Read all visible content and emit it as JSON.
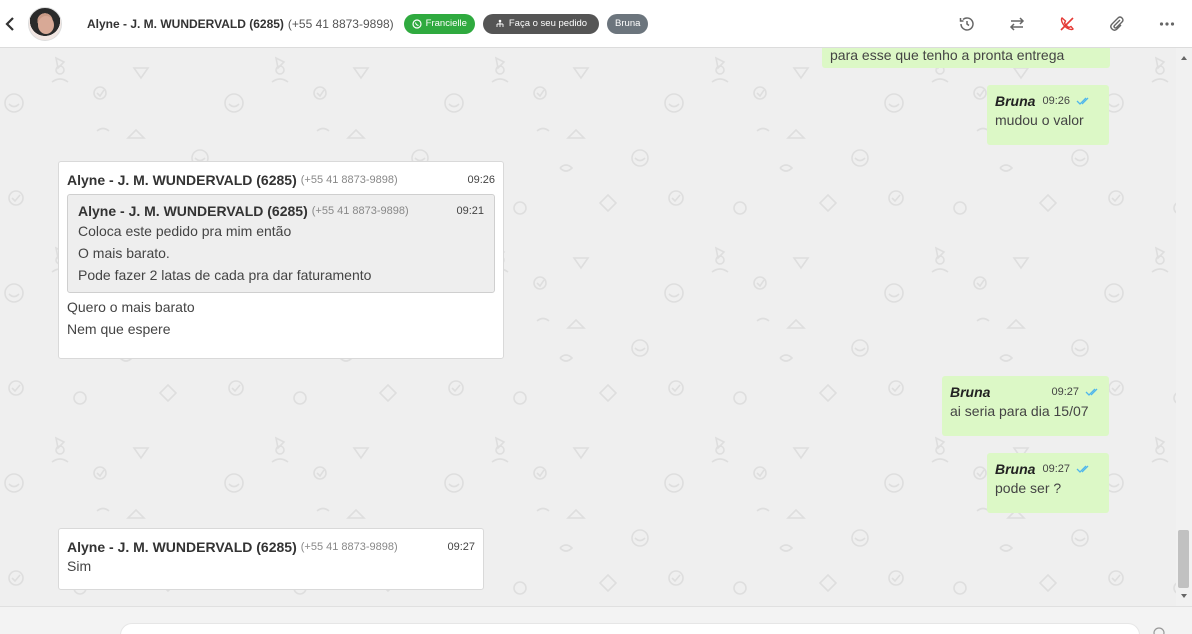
{
  "header": {
    "contact_name": "Alyne - J. M. WUNDERVALD (6285)",
    "contact_phone": "(+55 41 8873-9898)",
    "tags": [
      {
        "label": "Francielle",
        "icon": "whatsapp-icon",
        "color": "#2faa3f"
      },
      {
        "label": "Faça o seu pedido",
        "icon": "network-icon",
        "color": "#555555"
      },
      {
        "label": "Bruna",
        "icon": "",
        "color": "#6c757d"
      }
    ],
    "actions": [
      "history-icon",
      "transfer-icon",
      "end-call-icon",
      "attach-icon",
      "more-icon"
    ]
  },
  "messages": {
    "top_partial": {
      "text": "para esse que tenho a pronta entrega"
    },
    "out1": {
      "sender": "Bruna",
      "time": "09:26",
      "text": "mudou o valor"
    },
    "in1": {
      "sender": "Alyne - J. M. WUNDERVALD (6285)",
      "phone": "(+55 41 8873-9898)",
      "time": "09:26",
      "quote": {
        "sender": "Alyne - J. M. WUNDERVALD (6285)",
        "phone": "(+55 41 8873-9898)",
        "time": "09:21",
        "lines": [
          "Coloca este pedido pra mim então",
          "O mais barato.",
          "Pode fazer 2 latas de cada pra dar faturamento"
        ]
      },
      "lines": [
        "Quero o mais barato",
        "Nem que espere"
      ]
    },
    "out2": {
      "sender": "Bruna",
      "time": "09:27",
      "text": "ai seria para dia 15/07"
    },
    "out3": {
      "sender": "Bruna",
      "time": "09:27",
      "text": "pode ser ?"
    },
    "in2": {
      "sender": "Alyne - J. M. WUNDERVALD (6285)",
      "phone": "(+55 41 8873-9898)",
      "time": "09:27",
      "text": "Sim"
    }
  },
  "colors": {
    "outgoing_bubble": "#dcf8c6",
    "incoming_bubble": "#ffffff",
    "read_ticks": "#4fb6ec",
    "end_call": "#e53935"
  }
}
